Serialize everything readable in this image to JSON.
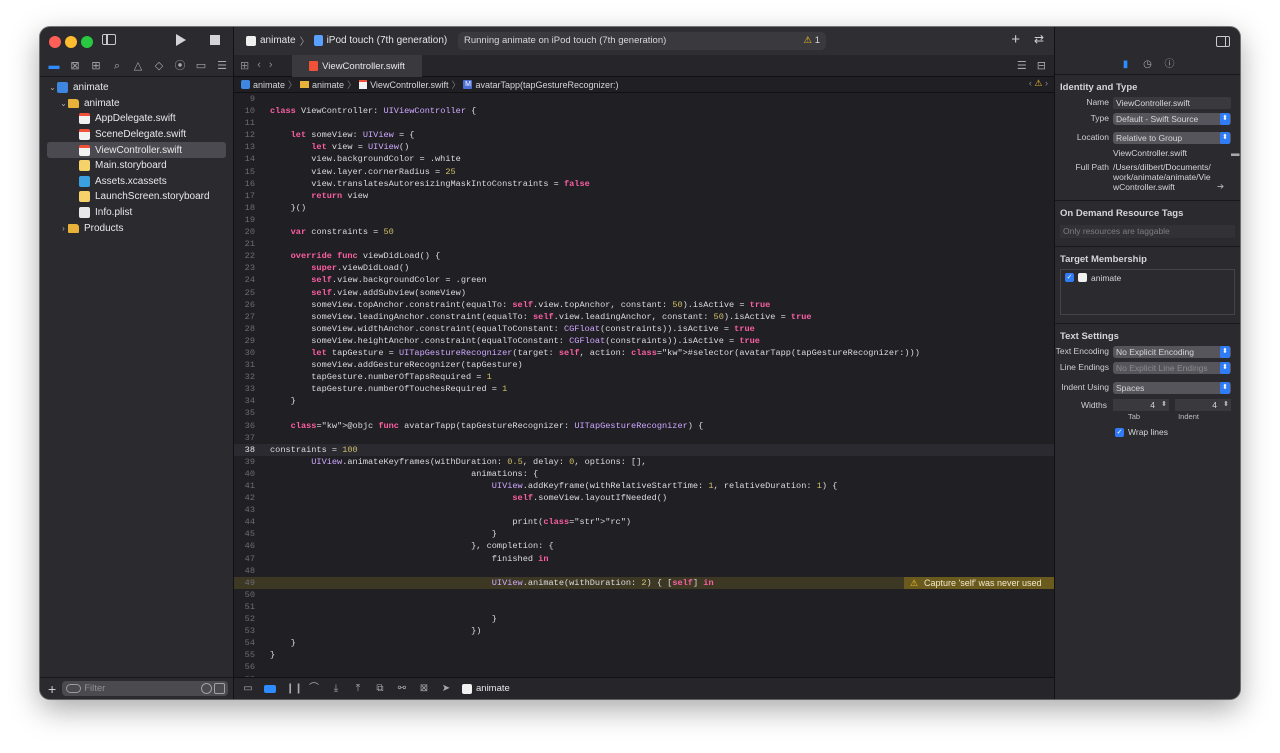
{
  "toolbar": {
    "scheme": "animate",
    "device": "iPod touch (7th generation)",
    "status": "Running animate on iPod touch (7th generation)",
    "warning_count": "1"
  },
  "tab": {
    "label": "ViewController.swift"
  },
  "jumpbar": {
    "items": [
      "animate",
      "animate",
      "ViewController.swift",
      "avatarTapp(tapGestureRecognizer:)"
    ]
  },
  "navigator": {
    "rows": [
      {
        "label": "animate",
        "indent": 0,
        "disc": "⌄",
        "icon": "project"
      },
      {
        "label": "animate",
        "indent": 1,
        "disc": "⌄",
        "icon": "folder"
      },
      {
        "label": "AppDelegate.swift",
        "indent": 2,
        "disc": "",
        "icon": "swift"
      },
      {
        "label": "SceneDelegate.swift",
        "indent": 2,
        "disc": "",
        "icon": "swift"
      },
      {
        "label": "ViewController.swift",
        "indent": 2,
        "disc": "",
        "icon": "swift",
        "selected": true
      },
      {
        "label": "Main.storyboard",
        "indent": 2,
        "disc": "",
        "icon": "storyboard"
      },
      {
        "label": "Assets.xcassets",
        "indent": 2,
        "disc": "",
        "icon": "assets"
      },
      {
        "label": "LaunchScreen.storyboard",
        "indent": 2,
        "disc": "",
        "icon": "storyboard"
      },
      {
        "label": "Info.plist",
        "indent": 2,
        "disc": "",
        "icon": "plist"
      },
      {
        "label": "Products",
        "indent": 1,
        "disc": "›",
        "icon": "folder"
      }
    ],
    "filter_placeholder": "Filter"
  },
  "code": [
    {
      "n": "9",
      "t": ""
    },
    {
      "n": "10",
      "t": "class ViewController: UIViewController {"
    },
    {
      "n": "11",
      "t": ""
    },
    {
      "n": "12",
      "t": "    let someView: UIView = {"
    },
    {
      "n": "13",
      "t": "        let view = UIView()"
    },
    {
      "n": "14",
      "t": "        view.backgroundColor = .white"
    },
    {
      "n": "15",
      "t": "        view.layer.cornerRadius = 25"
    },
    {
      "n": "16",
      "t": "        view.translatesAutoresizingMaskIntoConstraints = false"
    },
    {
      "n": "17",
      "t": "        return view"
    },
    {
      "n": "18",
      "t": "    }()"
    },
    {
      "n": "19",
      "t": ""
    },
    {
      "n": "20",
      "t": "    var constraints = 50"
    },
    {
      "n": "21",
      "t": ""
    },
    {
      "n": "22",
      "t": "    override func viewDidLoad() {"
    },
    {
      "n": "23",
      "t": "        super.viewDidLoad()"
    },
    {
      "n": "24",
      "t": "        self.view.backgroundColor = .green"
    },
    {
      "n": "25",
      "t": "        self.view.addSubview(someView)"
    },
    {
      "n": "26",
      "t": "        someView.topAnchor.constraint(equalTo: self.view.topAnchor, constant: 50).isActive = true"
    },
    {
      "n": "27",
      "t": "        someView.leadingAnchor.constraint(equalTo: self.view.leadingAnchor, constant: 50).isActive = true"
    },
    {
      "n": "28",
      "t": "        someView.widthAnchor.constraint(equalToConstant: CGFloat(constraints)).isActive = true"
    },
    {
      "n": "29",
      "t": "        someView.heightAnchor.constraint(equalToConstant: CGFloat(constraints)).isActive = true"
    },
    {
      "n": "30",
      "t": "        let tapGesture = UITapGestureRecognizer(target: self, action: #selector(avatarTapp(tapGestureRecognizer:)))"
    },
    {
      "n": "31",
      "t": "        someView.addGestureRecognizer(tapGesture)"
    },
    {
      "n": "32",
      "t": "        tapGesture.numberOfTapsRequired = 1"
    },
    {
      "n": "33",
      "t": "        tapGesture.numberOfTouchesRequired = 1"
    },
    {
      "n": "34",
      "t": "    }"
    },
    {
      "n": "35",
      "t": ""
    },
    {
      "n": "36",
      "t": "    @objc func avatarTapp(tapGestureRecognizer: UITapGestureRecognizer) {"
    },
    {
      "n": "37",
      "t": ""
    },
    {
      "n": "38",
      "t": "constraints = 100",
      "current": true
    },
    {
      "n": "39",
      "t": "        UIView.animateKeyframes(withDuration: 0.5, delay: 0, options: [],"
    },
    {
      "n": "40",
      "t": "                                       animations: {"
    },
    {
      "n": "41",
      "t": "                                           UIView.addKeyframe(withRelativeStartTime: 1, relativeDuration: 1) {"
    },
    {
      "n": "42",
      "t": "                                               self.someView.layoutIfNeeded()"
    },
    {
      "n": "43",
      "t": ""
    },
    {
      "n": "44",
      "t": "                                               print(\"rc\")"
    },
    {
      "n": "45",
      "t": "                                           }"
    },
    {
      "n": "46",
      "t": "                                       }, completion: {"
    },
    {
      "n": "47",
      "t": "                                           finished in"
    },
    {
      "n": "48",
      "t": ""
    },
    {
      "n": "49",
      "t": "                                           UIView.animate(withDuration: 2) { [self] in",
      "warning": "Capture 'self' was never used"
    },
    {
      "n": "50",
      "t": ""
    },
    {
      "n": "51",
      "t": ""
    },
    {
      "n": "52",
      "t": "                                           }"
    },
    {
      "n": "53",
      "t": "                                       })"
    },
    {
      "n": "54",
      "t": "    }"
    },
    {
      "n": "55",
      "t": "}"
    },
    {
      "n": "56",
      "t": ""
    },
    {
      "n": "57",
      "t": ""
    }
  ],
  "debug": {
    "target": "animate"
  },
  "inspector": {
    "identity_title": "Identity and Type",
    "name_label": "Name",
    "name_value": "ViewController.swift",
    "type_label": "Type",
    "type_value": "Default - Swift Source",
    "location_label": "Location",
    "location_value": "Relative to Group",
    "location_file": "ViewController.swift",
    "fullpath_label": "Full Path",
    "fullpath_value": "/Users/dilbert/Documents/work/animate/animate/ViewController.swift",
    "tags_title": "On Demand Resource Tags",
    "tags_placeholder": "Only resources are taggable",
    "membership_title": "Target Membership",
    "membership_target": "animate",
    "text_title": "Text Settings",
    "encoding_label": "Text Encoding",
    "encoding_value": "No Explicit Encoding",
    "endings_label": "Line Endings",
    "endings_value": "No Explicit Line Endings",
    "indent_label": "Indent Using",
    "indent_value": "Spaces",
    "widths_label": "Widths",
    "tab_value": "4",
    "indent_width_value": "4",
    "tab_caption": "Tab",
    "indent_caption": "Indent",
    "wrap_label": "Wrap lines"
  }
}
